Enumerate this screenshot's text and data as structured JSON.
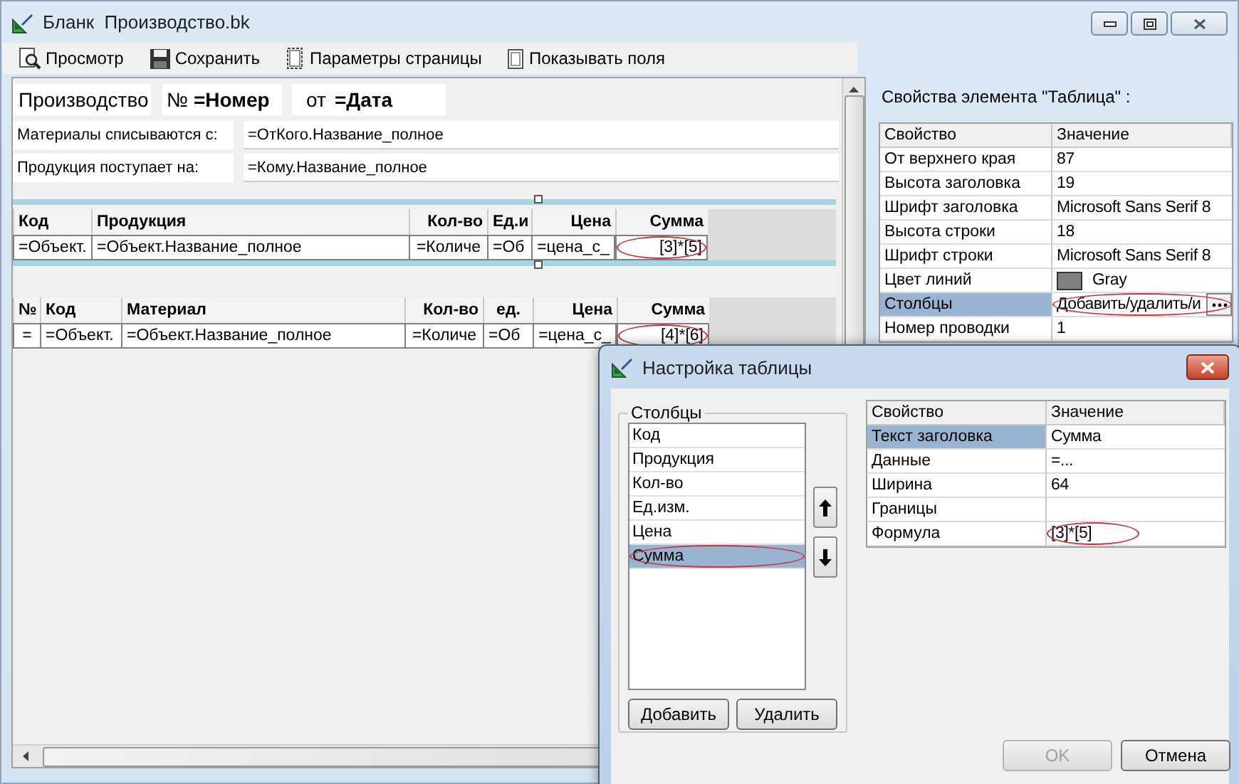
{
  "window": {
    "title": "Бланк  Производство.bk"
  },
  "toolbar": [
    {
      "label": "Просмотр"
    },
    {
      "label": "Сохранить"
    },
    {
      "label": "Параметры страницы"
    },
    {
      "label": "Показывать поля"
    }
  ],
  "header_fields": [
    {
      "text": "Производство",
      "bold": false
    },
    {
      "text": "№",
      "bold": false
    },
    {
      "text": "=Номер",
      "bold": true
    },
    {
      "text": "от",
      "bold": false
    },
    {
      "text": "=Дата",
      "bold": true
    }
  ],
  "bindings": [
    {
      "label": "Материалы списываются с:",
      "value": "=ОтКого.Название_полное"
    },
    {
      "label": "Продукция поступает на:",
      "value": "=Кому.Название_полное"
    }
  ],
  "tables": [
    {
      "columns": [
        "Код",
        "Продукция",
        "Кол-во",
        "Ед.и",
        "Цена",
        "Сумма"
      ],
      "row": [
        {
          "text": "=Объект.",
          "circled": false
        },
        {
          "text": "=Объект.Название_полное",
          "circled": false
        },
        {
          "text": "=Количе",
          "circled": false
        },
        {
          "text": "=Об",
          "circled": false
        },
        {
          "text": "=цена_с_",
          "circled": false
        },
        {
          "text": "[3]*[5]",
          "circled": true
        }
      ]
    },
    {
      "columns": [
        "№",
        "Код",
        "Материал",
        "Кол-во",
        "ед.",
        "Цена",
        "Сумма"
      ],
      "row": [
        {
          "text": "=",
          "circled": false
        },
        {
          "text": "=Объект.",
          "circled": false
        },
        {
          "text": "=Объект.Название_полное",
          "circled": false
        },
        {
          "text": "=Количе",
          "circled": false
        },
        {
          "text": "=Об",
          "circled": false
        },
        {
          "text": "=цена_с_",
          "circled": false
        },
        {
          "text": "[4]*[6]",
          "circled": true
        }
      ]
    }
  ],
  "properties": {
    "caption": "Свойства элемента \"Таблица\" :",
    "columns": [
      "Свойство",
      "Значение"
    ],
    "rows": [
      {
        "name": "От верхнего края",
        "value": "87",
        "kind": "text",
        "selected": false
      },
      {
        "name": "Высота заголовка",
        "value": "19",
        "kind": "text",
        "selected": false
      },
      {
        "name": "Шрифт заголовка",
        "value": "Microsoft Sans Serif 8",
        "kind": "text",
        "selected": false
      },
      {
        "name": "Высота строки",
        "value": "18",
        "kind": "text",
        "selected": false
      },
      {
        "name": "Шрифт строки",
        "value": "Microsoft Sans Serif 8",
        "kind": "text",
        "selected": false
      },
      {
        "name": "Цвет линий",
        "value": "Gray",
        "kind": "color",
        "color": "#808080",
        "selected": false
      },
      {
        "name": "Столбцы",
        "value": "Добавить/удалить/и",
        "kind": "editor",
        "selected": true,
        "circled": true
      },
      {
        "name": "Номер проводки",
        "value": "1",
        "kind": "text",
        "selected": false
      }
    ]
  },
  "dialog": {
    "title": "Настройка таблицы",
    "group_title": "Столбцы",
    "columns_list": [
      {
        "label": "Код",
        "selected": false,
        "circled": false
      },
      {
        "label": "Продукция",
        "selected": false,
        "circled": false
      },
      {
        "label": "Кол-во",
        "selected": false,
        "circled": false
      },
      {
        "label": "Ед.изм.",
        "selected": false,
        "circled": false
      },
      {
        "label": "Цена",
        "selected": false,
        "circled": false
      },
      {
        "label": "Сумма",
        "selected": true,
        "circled": true
      }
    ],
    "list_buttons": [
      {
        "label": "Добавить"
      },
      {
        "label": "Удалить"
      }
    ],
    "properties": {
      "columns": [
        "Свойство",
        "Значение"
      ],
      "rows": [
        {
          "name": "Текст заголовка",
          "value": "Сумма",
          "selected": true,
          "circled": false
        },
        {
          "name": "Данные",
          "value": "=...",
          "selected": false,
          "circled": false
        },
        {
          "name": "Ширина",
          "value": "64",
          "selected": false,
          "circled": false
        },
        {
          "name": "Границы",
          "value": "",
          "selected": false,
          "circled": false
        },
        {
          "name": "Формула",
          "value": "[3]*[5]",
          "selected": false,
          "circled": true
        }
      ]
    },
    "footer_buttons": [
      {
        "label": "OK",
        "disabled": true
      },
      {
        "label": "Отмена",
        "disabled": false
      }
    ]
  }
}
